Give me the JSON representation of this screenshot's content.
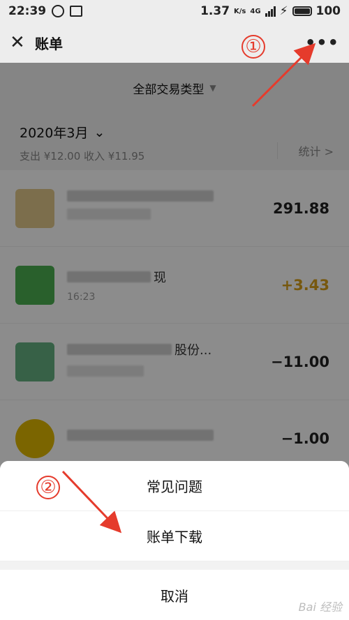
{
  "status_bar": {
    "time": "22:39",
    "speed": "1.37",
    "speed_unit": "K/s",
    "network": "4G",
    "battery": "100"
  },
  "nav": {
    "close_icon": "close-icon",
    "title": "账单",
    "more_icon": "more-icon"
  },
  "filter": {
    "label": "全部交易类型"
  },
  "month": {
    "title": "2020年3月",
    "summary": "支出 ¥12.00 收入 ¥11.95",
    "stats_label": "统计 >"
  },
  "transactions": [
    {
      "name": "",
      "sub": "",
      "amount": "291.88",
      "icon_color": "#d6b25a"
    },
    {
      "name": "现",
      "sub": "16:23",
      "amount": "+3.43",
      "icon_color": "#4caf50"
    },
    {
      "name": "股份...",
      "sub": "",
      "amount": "−11.00",
      "icon_color": "#3f9e62"
    },
    {
      "name": "",
      "sub": "",
      "amount": "−1.00",
      "icon_color": "#e0b800"
    }
  ],
  "action_sheet": {
    "items": [
      "常见问题",
      "账单下载"
    ],
    "cancel": "取消"
  },
  "annotations": {
    "one": "①",
    "two": "②",
    "color": "#e53b2c"
  },
  "watermark": "Bai 经验"
}
